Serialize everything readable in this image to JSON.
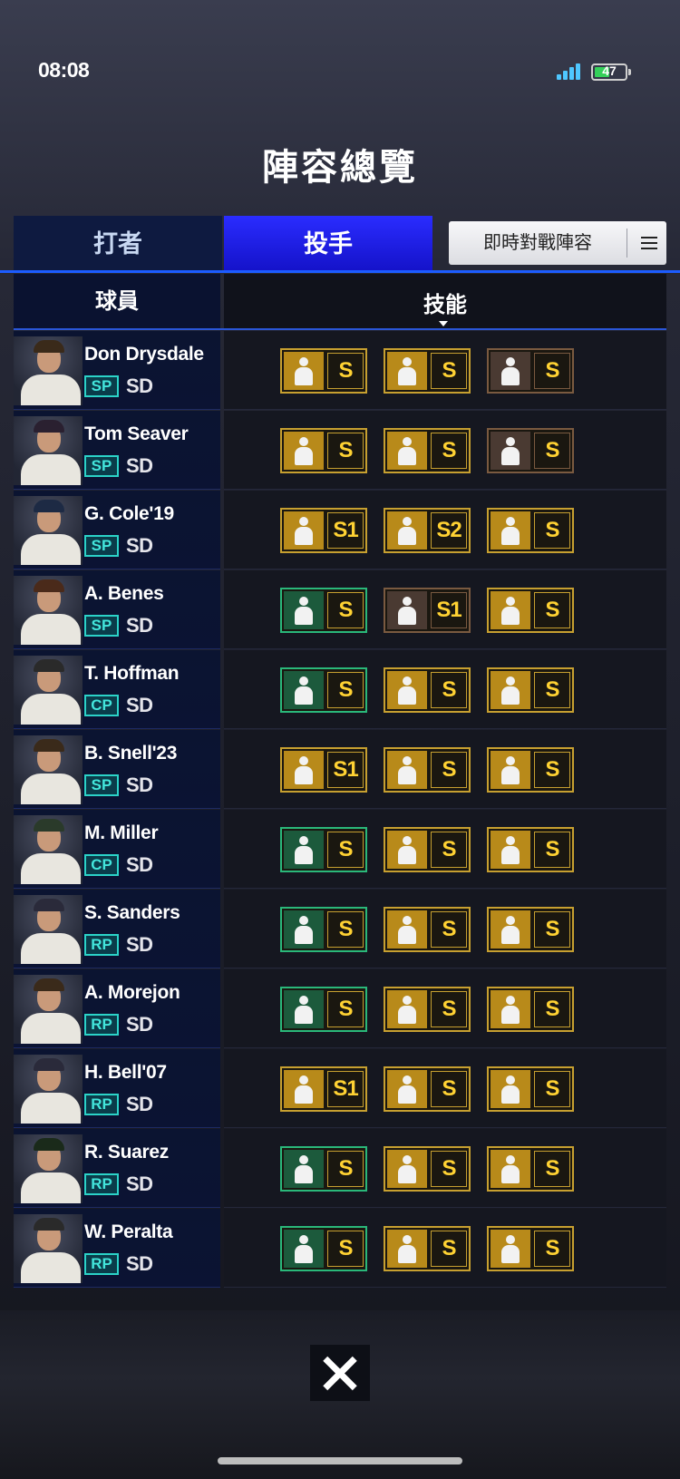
{
  "status": {
    "time": "08:08",
    "battery": "47"
  },
  "title": "陣容總覽",
  "tabs": {
    "hitter": "打者",
    "pitcher": "投手",
    "lineup_button": "即時對戰陣容"
  },
  "table": {
    "col_player": "球員",
    "col_skill": "技能"
  },
  "colors": {
    "accent": "#1412c8",
    "position_badge": "#2bd3c8",
    "grade_gold": "#ffd233"
  },
  "players": [
    {
      "name": "Don Drysdale",
      "pos": "SP",
      "team": "SD",
      "skills": [
        {
          "grade": "S",
          "frame": "gold",
          "icon": "pitcher-skill-icon"
        },
        {
          "grade": "S",
          "frame": "gold",
          "icon": "pitcher-skill-icon"
        },
        {
          "grade": "S",
          "frame": "brown",
          "icon": "pitcher-skill-icon"
        }
      ]
    },
    {
      "name": "Tom Seaver",
      "pos": "SP",
      "team": "SD",
      "skills": [
        {
          "grade": "S",
          "frame": "gold",
          "icon": "pitcher-skill-icon"
        },
        {
          "grade": "S",
          "frame": "gold",
          "icon": "pitcher-skill-icon"
        },
        {
          "grade": "S",
          "frame": "brown",
          "icon": "pitcher-skill-icon"
        }
      ]
    },
    {
      "name": "G. Cole'19",
      "pos": "SP",
      "team": "SD",
      "skills": [
        {
          "grade": "S1",
          "frame": "gold",
          "icon": "muscle-skill-icon"
        },
        {
          "grade": "S2",
          "frame": "gold",
          "icon": "jersey-skill-icon"
        },
        {
          "grade": "S",
          "frame": "gold",
          "icon": "pitcher-skill-icon"
        }
      ]
    },
    {
      "name": "A. Benes",
      "pos": "SP",
      "team": "SD",
      "skills": [
        {
          "grade": "S",
          "frame": "green",
          "icon": "arrow-skill-icon"
        },
        {
          "grade": "S1",
          "frame": "brown",
          "icon": "pitcher-skill-icon"
        },
        {
          "grade": "S",
          "frame": "gold",
          "icon": "muscle-skill-icon"
        }
      ]
    },
    {
      "name": "T. Hoffman",
      "pos": "CP",
      "team": "SD",
      "skills": [
        {
          "grade": "S",
          "frame": "green",
          "icon": "pitcher-skill-icon"
        },
        {
          "grade": "S",
          "frame": "gold",
          "icon": "lightning-skill-icon"
        },
        {
          "grade": "S",
          "frame": "gold",
          "icon": "pitcher-skill-icon"
        }
      ]
    },
    {
      "name": "B. Snell'23",
      "pos": "SP",
      "team": "SD",
      "skills": [
        {
          "grade": "S1",
          "frame": "gold",
          "icon": "muscle-skill-icon"
        },
        {
          "grade": "S",
          "frame": "gold",
          "icon": "recycle-skill-icon"
        },
        {
          "grade": "S",
          "frame": "gold",
          "icon": "vs-skill-icon"
        }
      ]
    },
    {
      "name": "M. Miller",
      "pos": "CP",
      "team": "SD",
      "skills": [
        {
          "grade": "S",
          "frame": "green",
          "icon": "pitcher-skill-icon"
        },
        {
          "grade": "S",
          "frame": "gold",
          "icon": "pitcher-skill-icon"
        },
        {
          "grade": "S",
          "frame": "gold",
          "icon": "recycle-skill-icon"
        }
      ]
    },
    {
      "name": "S. Sanders",
      "pos": "RP",
      "team": "SD",
      "skills": [
        {
          "grade": "S",
          "frame": "green",
          "icon": "pitcher-skill-icon"
        },
        {
          "grade": "S",
          "frame": "gold",
          "icon": "pitcher-skill-icon"
        },
        {
          "grade": "S",
          "frame": "gold",
          "icon": "lightning-skill-icon"
        }
      ]
    },
    {
      "name": "A. Morejon",
      "pos": "RP",
      "team": "SD",
      "skills": [
        {
          "grade": "S",
          "frame": "green",
          "icon": "pitcher-skill-icon"
        },
        {
          "grade": "S",
          "frame": "gold",
          "icon": "lightning-skill-icon"
        },
        {
          "grade": "S",
          "frame": "gold",
          "icon": "pitcher-skill-icon"
        }
      ]
    },
    {
      "name": "H. Bell'07",
      "pos": "RP",
      "team": "SD",
      "skills": [
        {
          "grade": "S1",
          "frame": "gold",
          "icon": "recycle-skill-icon"
        },
        {
          "grade": "S",
          "frame": "gold",
          "icon": "pitcher-skill-icon"
        },
        {
          "grade": "S",
          "frame": "gold",
          "icon": "glove-skill-icon"
        }
      ]
    },
    {
      "name": "R. Suarez",
      "pos": "RP",
      "team": "SD",
      "skills": [
        {
          "grade": "S",
          "frame": "green",
          "icon": "pitcher-skill-icon"
        },
        {
          "grade": "S",
          "frame": "gold",
          "icon": "lightning-skill-icon"
        },
        {
          "grade": "S",
          "frame": "gold",
          "icon": "vs-skill-icon"
        }
      ]
    },
    {
      "name": "W. Peralta",
      "pos": "RP",
      "team": "SD",
      "skills": [
        {
          "grade": "S",
          "frame": "green",
          "icon": "pitcher-skill-icon"
        },
        {
          "grade": "S",
          "frame": "gold",
          "icon": "vs-skill-icon"
        },
        {
          "grade": "S",
          "frame": "gold",
          "icon": "muscle-skill-icon"
        }
      ]
    }
  ]
}
